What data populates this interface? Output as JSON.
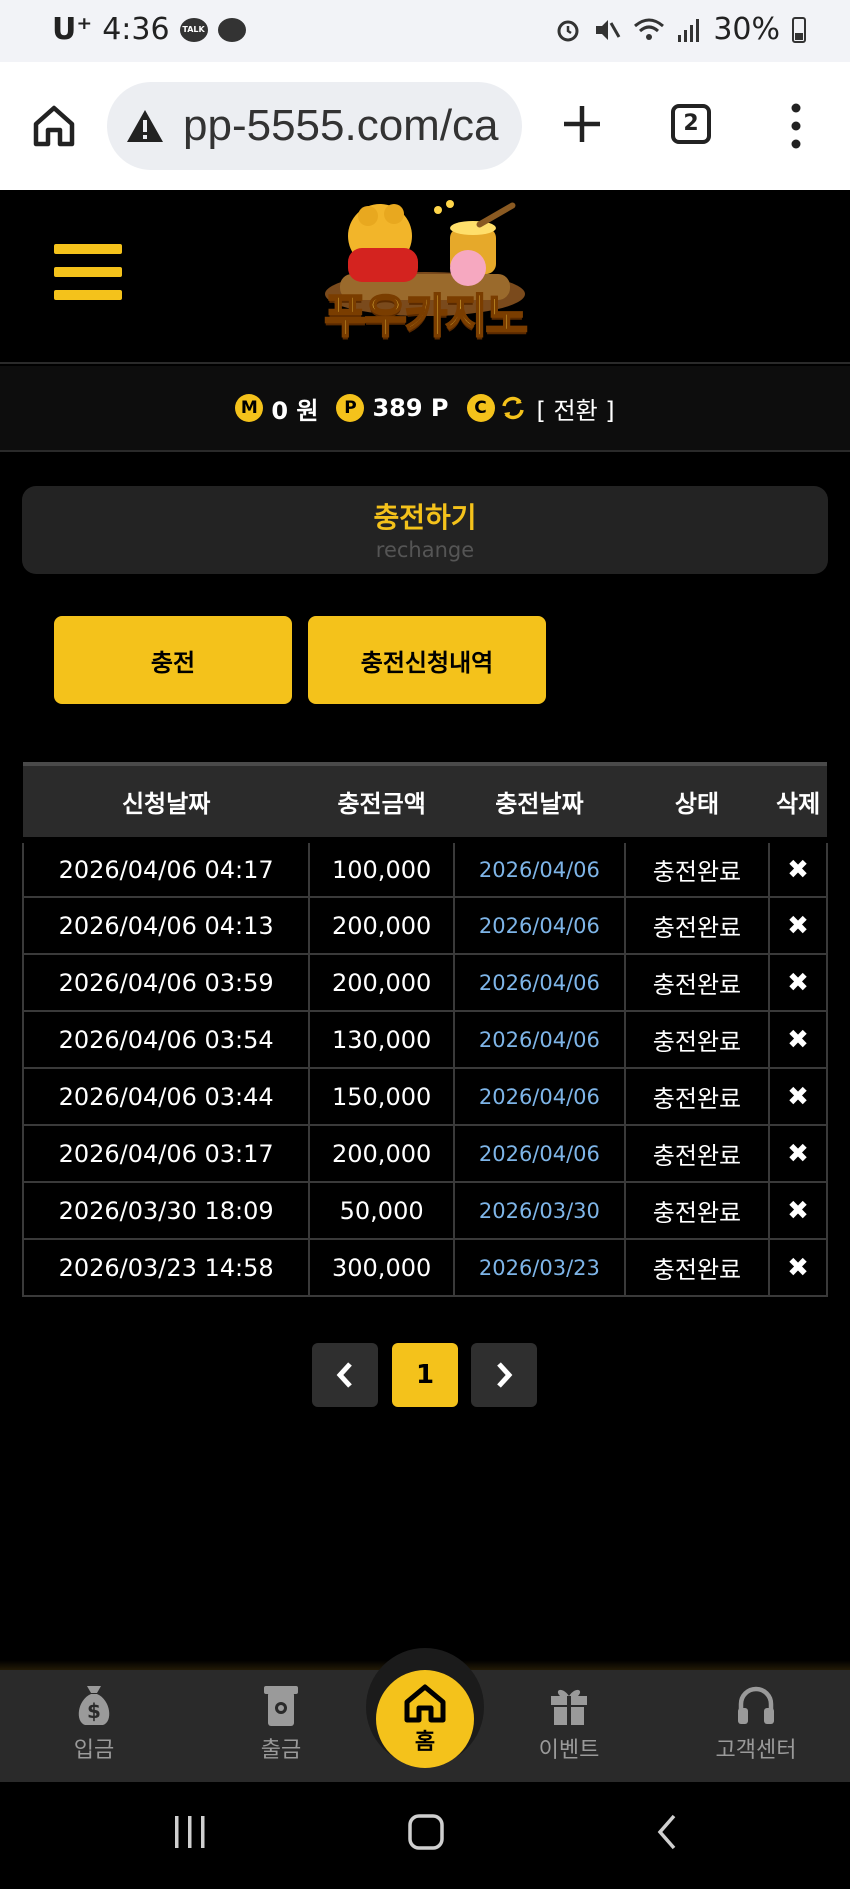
{
  "status_bar": {
    "carrier": "U⁺",
    "time": "4:36",
    "talk_badge": "TALK",
    "battery": "30%"
  },
  "browser": {
    "url": "pp-5555.com/ca",
    "tab_count": "2"
  },
  "site": {
    "logo_text": "푸우카지노"
  },
  "balance": {
    "money_badge": "M",
    "money": "0 원",
    "point_badge": "P",
    "points": "389 P",
    "convert_badge": "C",
    "convert_label": "[ 전환 ]"
  },
  "section": {
    "title": "충전하기",
    "subtitle": "rechange"
  },
  "tabs": {
    "charge": "충전",
    "history": "충전신청내역"
  },
  "table": {
    "headers": [
      "신청날짜",
      "충전금액",
      "충전날짜",
      "상태",
      "삭제"
    ],
    "rows": [
      {
        "request_date": "2026/04/06 04:17",
        "amount": "100,000",
        "charge_date": "2026/04/06",
        "status": "충전완료",
        "delete": "✖"
      },
      {
        "request_date": "2026/04/06 04:13",
        "amount": "200,000",
        "charge_date": "2026/04/06",
        "status": "충전완료",
        "delete": "✖"
      },
      {
        "request_date": "2026/04/06 03:59",
        "amount": "200,000",
        "charge_date": "2026/04/06",
        "status": "충전완료",
        "delete": "✖"
      },
      {
        "request_date": "2026/04/06 03:54",
        "amount": "130,000",
        "charge_date": "2026/04/06",
        "status": "충전완료",
        "delete": "✖"
      },
      {
        "request_date": "2026/04/06 03:44",
        "amount": "150,000",
        "charge_date": "2026/04/06",
        "status": "충전완료",
        "delete": "✖"
      },
      {
        "request_date": "2026/04/06 03:17",
        "amount": "200,000",
        "charge_date": "2026/04/06",
        "status": "충전완료",
        "delete": "✖"
      },
      {
        "request_date": "2026/03/30 18:09",
        "amount": "50,000",
        "charge_date": "2026/03/30",
        "status": "충전완료",
        "delete": "✖"
      },
      {
        "request_date": "2026/03/23 14:58",
        "amount": "300,000",
        "charge_date": "2026/03/23",
        "status": "충전완료",
        "delete": "✖"
      }
    ]
  },
  "pagination": {
    "current": "1"
  },
  "bottom_nav": {
    "deposit": "입금",
    "withdraw": "출금",
    "home": "홈",
    "event": "이벤트",
    "support": "고객센터"
  },
  "colors": {
    "accent": "#f4c21b",
    "charge_date_text": "#7eb5e8",
    "background": "#000000"
  }
}
